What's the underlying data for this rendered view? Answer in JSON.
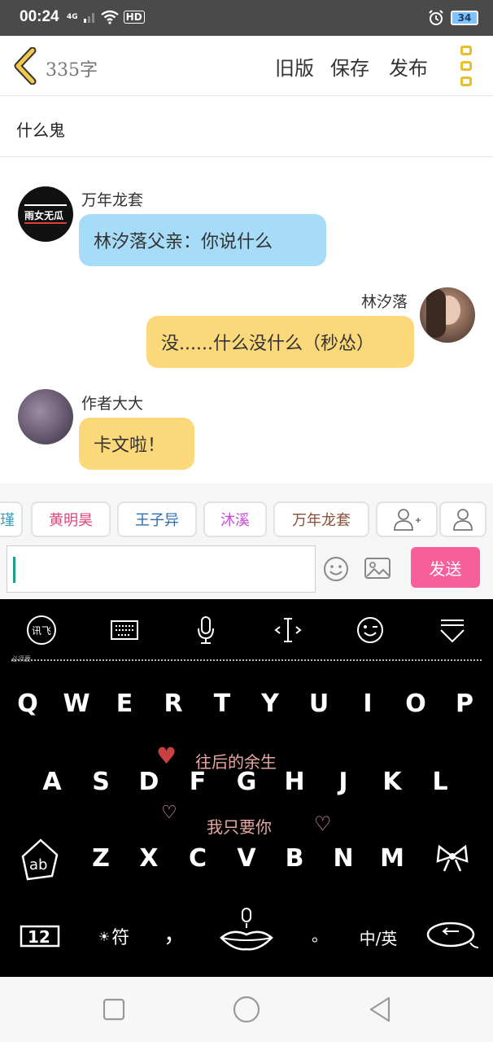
{
  "status_bar": {
    "time": "00:24",
    "signal": "4G",
    "hd": "HD",
    "battery": "34"
  },
  "toolbar": {
    "word_count": "335字",
    "old_version_label": "旧版",
    "save_label": "保存",
    "publish_label": "发布"
  },
  "title": "什么鬼",
  "chat": {
    "messages": [
      {
        "sender": "万年龙套",
        "text": "林汐落父亲：你说什么",
        "side": "left",
        "color": "blue"
      },
      {
        "sender": "林汐落",
        "text": "没......什么没什么（秒怂）",
        "side": "right",
        "color": "yellow"
      },
      {
        "sender": "作者大大",
        "text": "卡文啦！",
        "side": "left",
        "color": "yellow"
      }
    ],
    "avatar_1_text": "雨女无瓜"
  },
  "characters": [
    {
      "name": "瑾",
      "color": "#3aa0c0"
    },
    {
      "name": "黄明昊",
      "color": "#e0457a"
    },
    {
      "name": "王子异",
      "color": "#2b6fb0"
    },
    {
      "name": "沐溪",
      "color": "#c64bd6"
    },
    {
      "name": "万年龙套",
      "color": "#8b4d36"
    }
  ],
  "input": {
    "placeholder": "",
    "send_label": "发送"
  },
  "keyboard": {
    "row1": [
      "Q",
      "W",
      "E",
      "R",
      "T",
      "Y",
      "U",
      "I",
      "O",
      "P"
    ],
    "row2": [
      "A",
      "S",
      "D",
      "F",
      "G",
      "H",
      "J",
      "K",
      "L"
    ],
    "row3": [
      "Z",
      "X",
      "C",
      "V",
      "B",
      "N",
      "M"
    ],
    "deco_line1": "往后的余生",
    "deco_line2": "我只要你",
    "ifly_label": "讯飞",
    "shift_label": "ab",
    "num_label": "12",
    "symbol_label": "符",
    "comma_label": "，",
    "period_label": "。",
    "lang_label": "中/英",
    "tiny_hint": "必须要"
  },
  "colors": {
    "accent_yellow": "#e7bf2c",
    "send_pink": "#f7609a",
    "bubble_blue": "#a6dcf7",
    "bubble_yellow": "#fbd97a"
  }
}
